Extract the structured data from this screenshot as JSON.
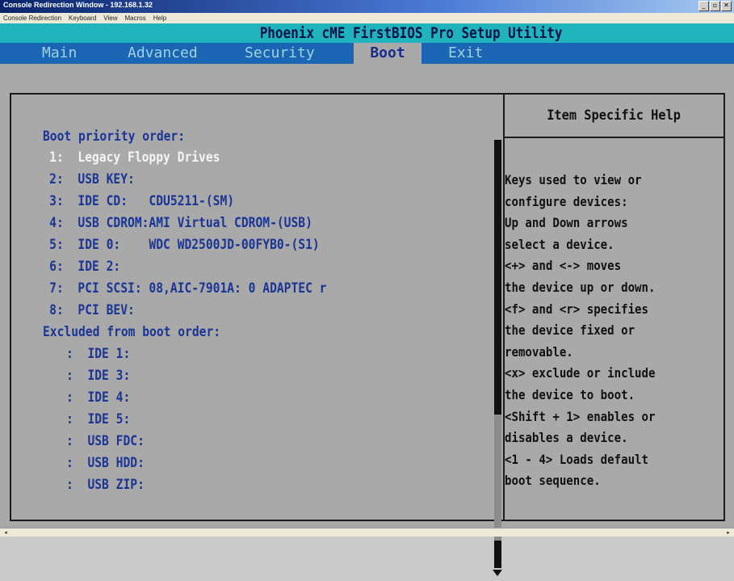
{
  "window": {
    "title": "Console Redirection Window - 192.168.1.32",
    "buttons": [
      "_",
      "▫",
      "✕"
    ]
  },
  "menubar": [
    "Console Redirection",
    "Keyboard",
    "View",
    "Macros",
    "Help"
  ],
  "bios": {
    "title": "Phoenix cME FirstBIOS Pro Setup Utility",
    "tabs": [
      {
        "label": "Main",
        "active": false
      },
      {
        "label": "Advanced",
        "active": false
      },
      {
        "label": "Security",
        "active": false
      },
      {
        "label": "Boot",
        "active": true
      },
      {
        "label": "Exit",
        "active": false
      }
    ],
    "boot_priority_heading": "Boot priority order:",
    "boot_priority": [
      {
        "num": "1:",
        "label": "Legacy Floppy Drives",
        "selected": true
      },
      {
        "num": "2:",
        "label": "USB KEY:"
      },
      {
        "num": "3:",
        "label": "IDE CD:   CDU5211-(SM)"
      },
      {
        "num": "4:",
        "label": "USB CDROM:AMI Virtual CDROM-(USB)"
      },
      {
        "num": "5:",
        "label": "IDE 0:    WDC WD2500JD-00FYB0-(S1)"
      },
      {
        "num": "6:",
        "label": "IDE 2:"
      },
      {
        "num": "7:",
        "label": "PCI SCSI: 08,AIC-7901A: 0 ADAPTEC r"
      },
      {
        "num": "8:",
        "label": "PCI BEV:"
      }
    ],
    "excluded_heading": "Excluded from boot order:",
    "excluded": [
      {
        "num": ":",
        "label": "IDE 1:"
      },
      {
        "num": ":",
        "label": "IDE 3:"
      },
      {
        "num": ":",
        "label": "IDE 4:"
      },
      {
        "num": ":",
        "label": "IDE 5:"
      },
      {
        "num": ":",
        "label": "USB FDC:"
      },
      {
        "num": ":",
        "label": "USB HDD:"
      },
      {
        "num": ":",
        "label": "USB ZIP:"
      }
    ],
    "help_title": "Item Specific Help",
    "help_lines": [
      "Keys used to view or",
      "configure devices:",
      "Up and Down arrows",
      "select a device.",
      "<+> and <-> moves",
      "the device up or down.",
      "<f> and <r> specifies",
      "the device fixed or",
      "removable.",
      "<x> exclude or include",
      "the device to boot.",
      "<Shift + 1> enables or",
      "disables a device.",
      "<1 - 4> Loads default",
      "boot sequence."
    ]
  },
  "colors": {
    "title_bar": "#1fb3bd",
    "tab_bar": "#1a66b4",
    "panel_bg": "#a9a9a9",
    "item_text": "#1b3594",
    "selected_text": "#f4f4f4"
  },
  "scroll_arrows": {
    "left": "◂",
    "right": "▸"
  }
}
